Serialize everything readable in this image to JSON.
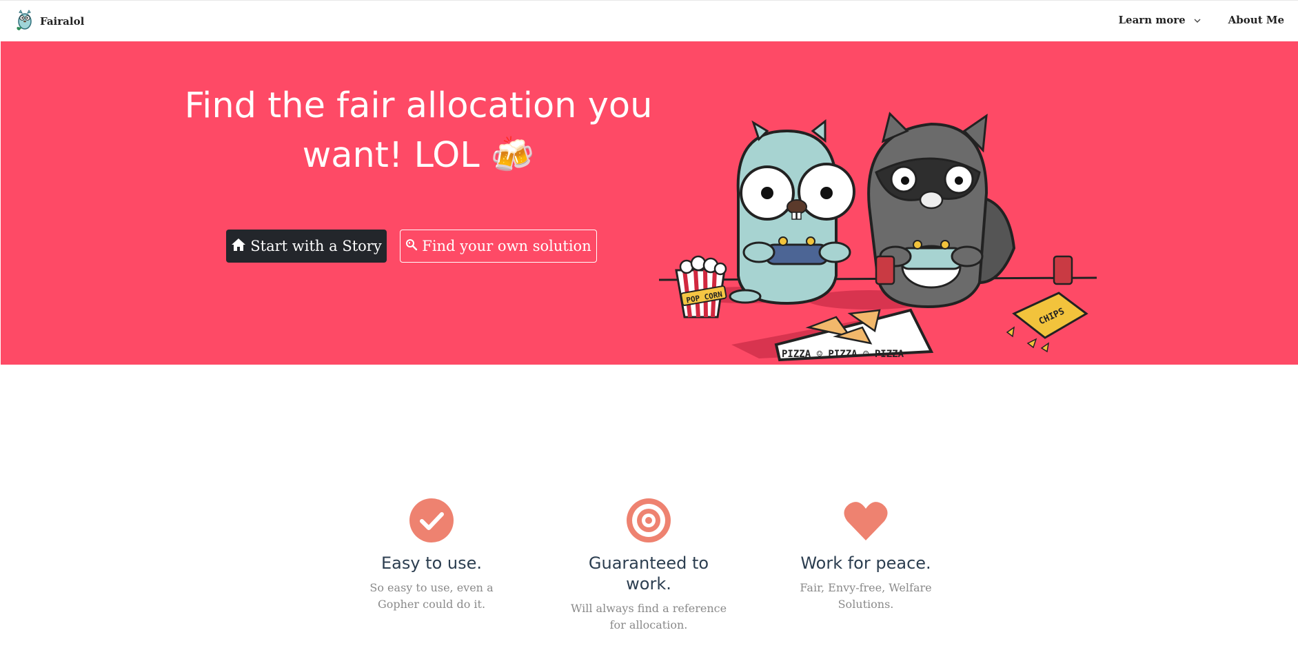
{
  "navbar": {
    "brand": "Fairalol",
    "logo_icon": "gopher-logo-icon",
    "learn_more": "Learn more",
    "about_me": "About Me"
  },
  "hero": {
    "title": "Find the fair allocation you want! LOL 🍻",
    "primary_button": {
      "label": "Start with a Story",
      "icon": "home-icon"
    },
    "secondary_button": {
      "label": "Find your own solution",
      "icon": "search-icon"
    },
    "illustration": {
      "text_popcorn": "POP CORN",
      "text_pizza": "PIZZA ☺ PIZZA ☺ PIZZA",
      "text_chips": "CHIPS"
    }
  },
  "features": [
    {
      "title": "Easy to use.",
      "description": "So easy to use, even a Gopher could do it.",
      "icon": "check-circle-icon"
    },
    {
      "title": "Guaranteed to work.",
      "description": "Will always find a reference for allocation.",
      "icon": "target-icon"
    },
    {
      "title": "Work for peace.",
      "description": "Fair, Envy-free, Welfare Solutions.",
      "icon": "heart-icon"
    }
  ],
  "colors": {
    "hero_bg": "#fe4a66",
    "accent": "#ee8270",
    "dark_button": "#23262b"
  }
}
